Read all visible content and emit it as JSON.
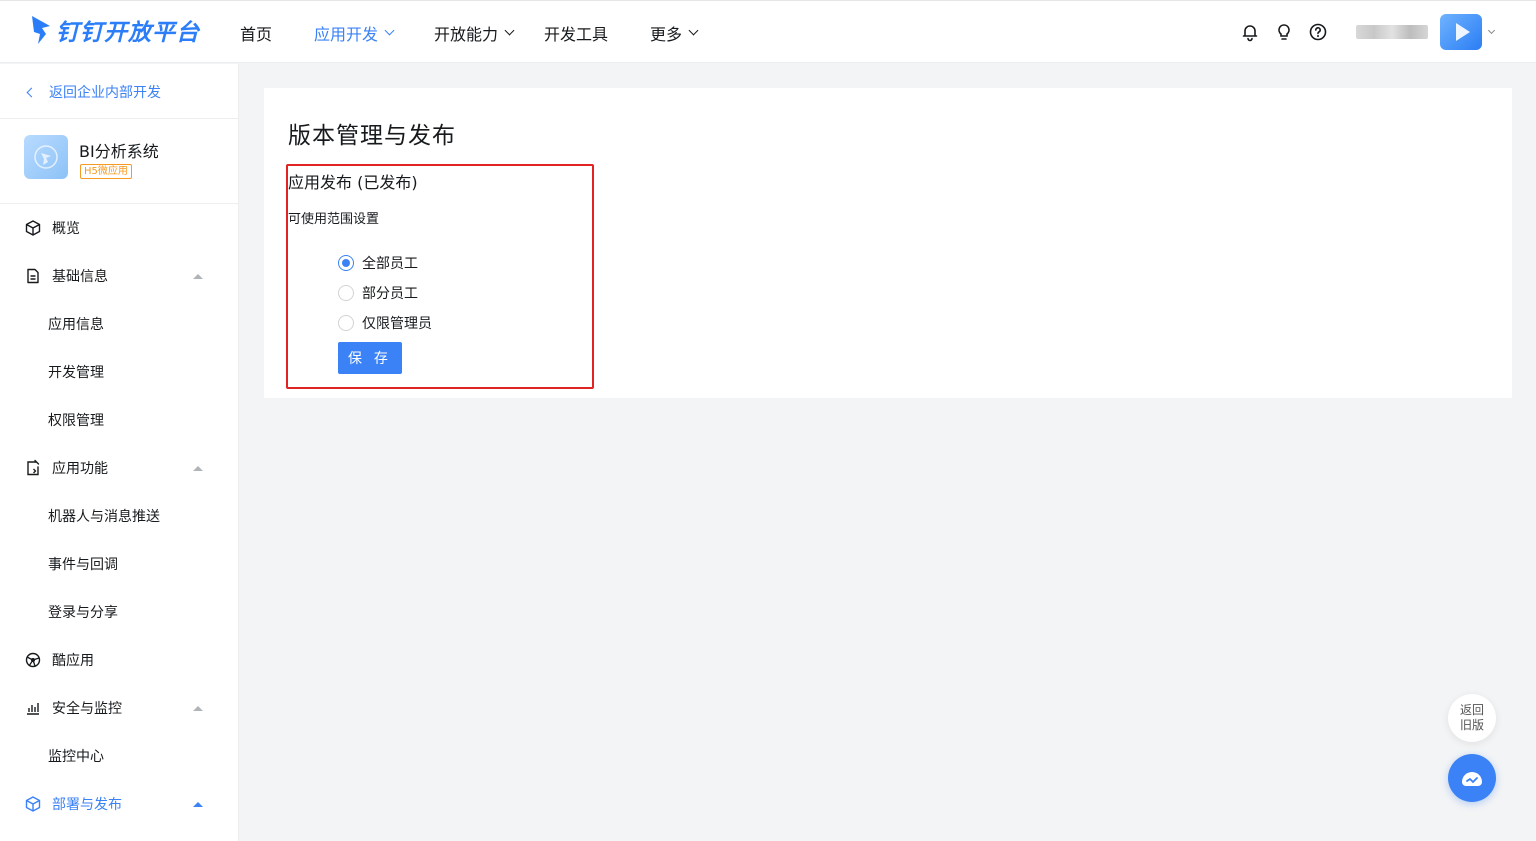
{
  "brand": {
    "name": "钉钉开放平台",
    "accent": "#3b82f6"
  },
  "topnav": {
    "items": [
      {
        "label": "首页",
        "active": false,
        "dropdown": false
      },
      {
        "label": "应用开发",
        "active": true,
        "dropdown": true
      },
      {
        "label": "开放能力",
        "active": false,
        "dropdown": true
      },
      {
        "label": "开发工具",
        "active": false,
        "dropdown": false
      },
      {
        "label": "更多",
        "active": false,
        "dropdown": true
      }
    ],
    "icons": [
      "bell-icon",
      "lightbulb-icon",
      "help-icon"
    ]
  },
  "sidebar": {
    "back_label": "返回企业内部开发",
    "app": {
      "name": "BI分析系统",
      "tag": "H5微应用"
    },
    "menu": [
      {
        "label": "概览",
        "icon": "cube-icon",
        "type": "group"
      },
      {
        "label": "基础信息",
        "icon": "document-icon",
        "type": "group",
        "expanded": true
      },
      {
        "label": "应用信息",
        "type": "sub"
      },
      {
        "label": "开发管理",
        "type": "sub"
      },
      {
        "label": "权限管理",
        "type": "sub"
      },
      {
        "label": "应用功能",
        "icon": "app-feature-icon",
        "type": "group",
        "expanded": true
      },
      {
        "label": "机器人与消息推送",
        "type": "sub"
      },
      {
        "label": "事件与回调",
        "type": "sub"
      },
      {
        "label": "登录与分享",
        "type": "sub"
      },
      {
        "label": "酷应用",
        "icon": "cool-app-icon",
        "type": "group"
      },
      {
        "label": "安全与监控",
        "icon": "bar-chart-icon",
        "type": "group",
        "expanded": true
      },
      {
        "label": "监控中心",
        "type": "sub"
      },
      {
        "label": "部署与发布",
        "icon": "cube-icon",
        "type": "group",
        "expanded": true,
        "active": true
      }
    ]
  },
  "main": {
    "title": "版本管理与发布",
    "section_title": "应用发布 (已发布)",
    "scope_label": "可使用范围设置",
    "scope_options": [
      {
        "label": "全部员工",
        "checked": true
      },
      {
        "label": "部分员工",
        "checked": false
      },
      {
        "label": "仅限管理员",
        "checked": false
      }
    ],
    "save_label": "保 存"
  },
  "floating": {
    "old_version_line1": "返回",
    "old_version_line2": "旧版"
  }
}
